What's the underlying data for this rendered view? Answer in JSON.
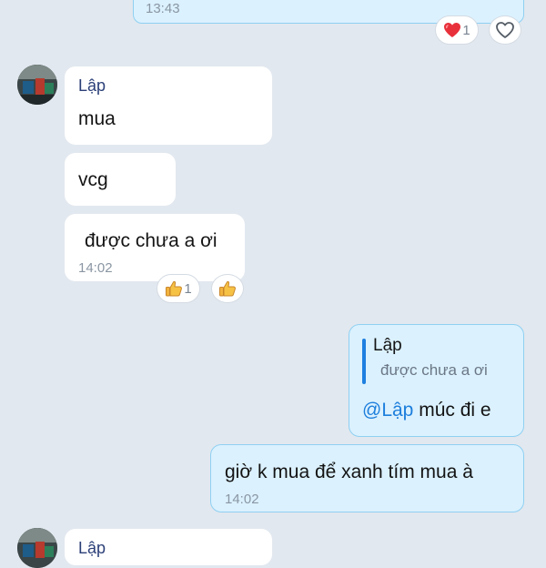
{
  "previous_message": {
    "time": "13:43",
    "reactions": {
      "heart_count": "1"
    }
  },
  "incoming_group": {
    "sender": "Lập",
    "messages": [
      {
        "text": "mua"
      },
      {
        "text": "vcg"
      },
      {
        "text": "được chưa a ơi",
        "time": "14:02"
      }
    ],
    "reactions": {
      "like_count": "1"
    }
  },
  "outgoing_reply": {
    "quote": {
      "name": "Lập",
      "text": "được chưa a ơi"
    },
    "mention": "@Lập",
    "text": "múc đi e"
  },
  "outgoing_message": {
    "text": "giờ k mua để xanh tím mua à",
    "time": "14:02"
  },
  "next_group": {
    "sender": "Lập"
  },
  "colors": {
    "background": "#e2e8ef",
    "outgoing_bubble": "#dbf1fe",
    "outgoing_border": "#8fd0f2",
    "mention": "#1d7fdc",
    "heart": "#e8303b"
  }
}
